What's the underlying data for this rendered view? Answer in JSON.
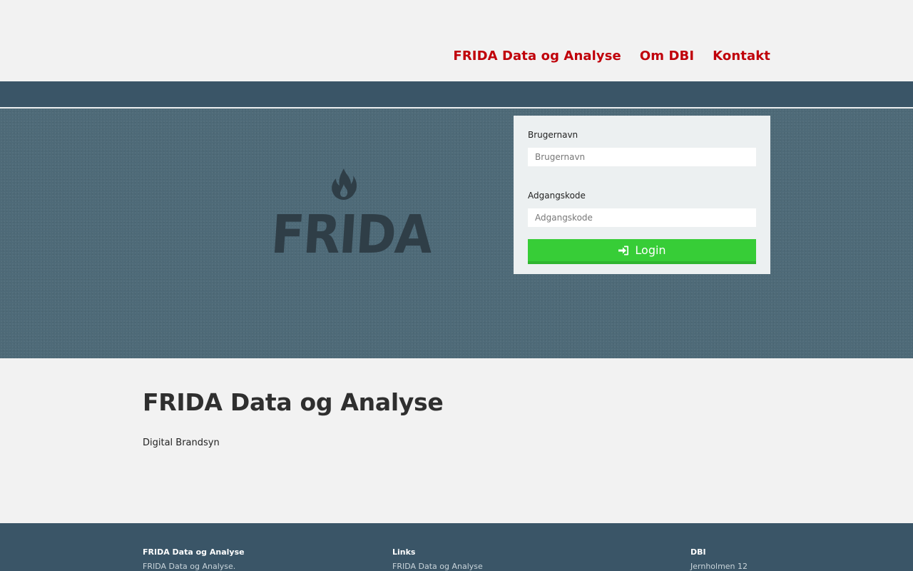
{
  "nav": {
    "items": [
      {
        "label": "FRIDA Data og Analyse"
      },
      {
        "label": "Om DBI"
      },
      {
        "label": "Kontakt"
      }
    ]
  },
  "hero": {
    "logo_text": "FRIDA"
  },
  "login": {
    "username_label": "Brugernavn",
    "username_placeholder": "Brugernavn",
    "password_label": "Adgangskode",
    "password_placeholder": "Adgangskode",
    "button_label": "Login",
    "button_color": "#37cd37"
  },
  "main": {
    "title": "FRIDA Data og Analyse",
    "subtitle": "Digital Brandsyn"
  },
  "footer": {
    "col1": {
      "heading": "FRIDA Data og Analyse",
      "text": "FRIDA Data og Analyse."
    },
    "col2": {
      "heading": "Links",
      "text": "FRIDA Data og Analyse"
    },
    "col3": {
      "heading": "DBI",
      "text": "Jernholmen 12"
    }
  },
  "colors": {
    "accent": "#c0000a",
    "band": "#3a5567",
    "hero": "#4e6a78"
  }
}
